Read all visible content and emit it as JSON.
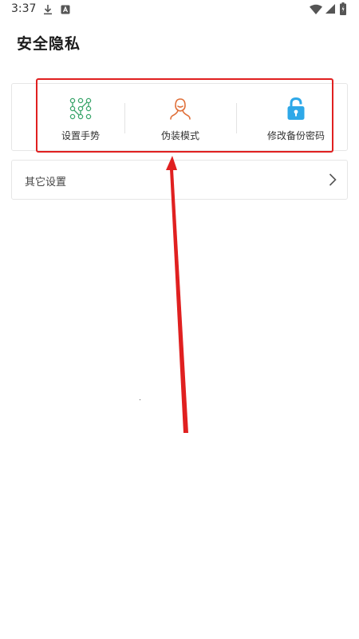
{
  "status_bar": {
    "time": "3:37",
    "icons": [
      "download-icon",
      "app-notification-icon",
      "wifi-icon",
      "signal-icon",
      "battery-icon"
    ]
  },
  "page": {
    "title": "安全隐私"
  },
  "options": [
    {
      "label": "设置手势",
      "icon": "gesture-pattern-icon",
      "color": "#3aa56b"
    },
    {
      "label": "伪装模式",
      "icon": "person-outline-icon",
      "color": "#e0703a"
    },
    {
      "label": "修改备份密码",
      "icon": "lock-icon",
      "color": "#2ea8e8"
    }
  ],
  "other_settings": {
    "label": "其它设置",
    "icon": "chevron-right-icon"
  },
  "annotation": {
    "color": "#e02020"
  }
}
